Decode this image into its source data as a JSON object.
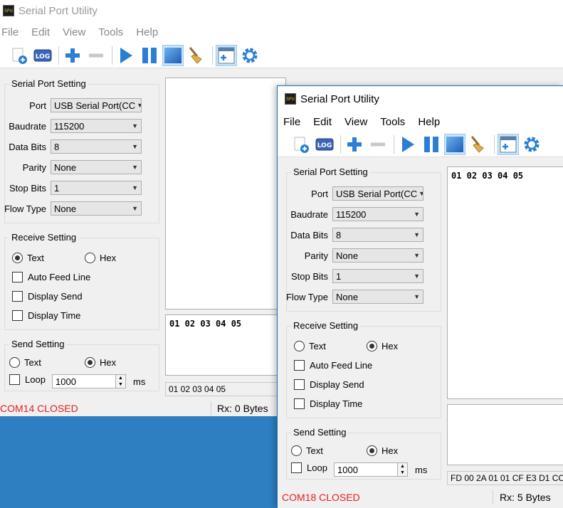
{
  "app": {
    "title": "Serial Port Utility",
    "icon_text": "SPU"
  },
  "menu": [
    "File",
    "Edit",
    "View",
    "Tools",
    "Help"
  ],
  "toolbar": [
    "new-log-icon",
    "log-icon",
    "add-icon",
    "remove-icon",
    "play-icon",
    "pause-icon",
    "window-icon",
    "broom-icon",
    "layout-icon",
    "gear-icon"
  ],
  "serial_setting": {
    "title": "Serial Port Setting",
    "labels": {
      "port": "Port",
      "baudrate": "Baudrate",
      "databits": "Data Bits",
      "parity": "Parity",
      "stopbits": "Stop Bits",
      "flowtype": "Flow Type"
    },
    "values": {
      "port": "USB Serial Port(CC",
      "baudrate": "115200",
      "databits": "8",
      "parity": "None",
      "stopbits": "1",
      "flowtype": "None"
    }
  },
  "receive_setting": {
    "title": "Receive Setting",
    "text": "Text",
    "hex": "Hex",
    "auto_feed": "Auto Feed Line",
    "display_send": "Display Send",
    "display_time": "Display Time"
  },
  "send_setting": {
    "title": "Send Setting",
    "text": "Text",
    "hex": "Hex",
    "loop": "Loop",
    "loop_value": "1000",
    "ms": "ms"
  },
  "windows": {
    "back": {
      "receive_text": "",
      "send_text": "01 02 03 04 05",
      "hex_bar": "01 02 03 04 05",
      "status_port": "COM14 CLOSED",
      "status_rx": "Rx: 0 Bytes"
    },
    "front": {
      "receive_text": "01 02 03 04 05",
      "send_text": "",
      "hex_bar": "FD 00 2A 01 01 CF E3 D1 CC",
      "status_port": "COM18 CLOSED",
      "status_rx": "Rx: 5 Bytes"
    }
  },
  "colors": {
    "accent_red": "#e32020",
    "desktop_blue": "#2d7fc2",
    "selected_tool": "#cce4f7"
  }
}
